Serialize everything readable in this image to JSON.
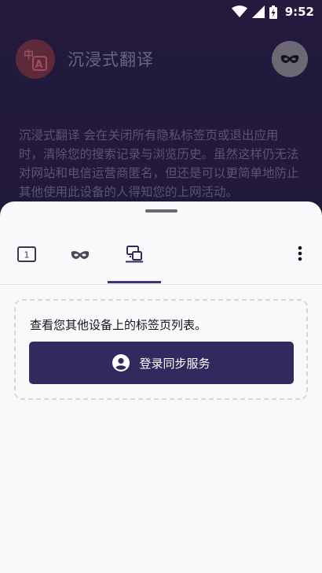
{
  "status_bar": {
    "time": "9:52",
    "icons": [
      "wifi-icon",
      "signal-icon",
      "battery-charging-icon"
    ]
  },
  "home": {
    "logo_icon": "translate-logo-icon",
    "app_name": "沉浸式翻译",
    "private_mode_icon": "mask-icon",
    "private_description": "沉浸式翻译 会在关闭所有隐私标签页或退出应用时，清除您的搜索记录与浏览历史。虽然这样仍无法对网站和电信运营商匿名，但还是可以更简单地防止其他使用此设备的人得知您的上网活动。"
  },
  "tab_tray": {
    "tabs": [
      {
        "name": "normal-tabs",
        "count": "1",
        "icon": "tab-counter-icon"
      },
      {
        "name": "private-tabs",
        "icon": "mask-icon"
      },
      {
        "name": "synced-tabs",
        "icon": "synced-devices-icon",
        "selected": true
      }
    ],
    "menu_icon": "more-vert-icon",
    "synced": {
      "message": "查看您其他设备上的标签页列表。",
      "signin_label": "登录同步服务",
      "signin_icon": "account-icon"
    }
  },
  "colors": {
    "background": "#1e1736",
    "sheet": "#f9f9fb",
    "primary_button": "#32295e",
    "tab_indicator": "#3f3573"
  }
}
